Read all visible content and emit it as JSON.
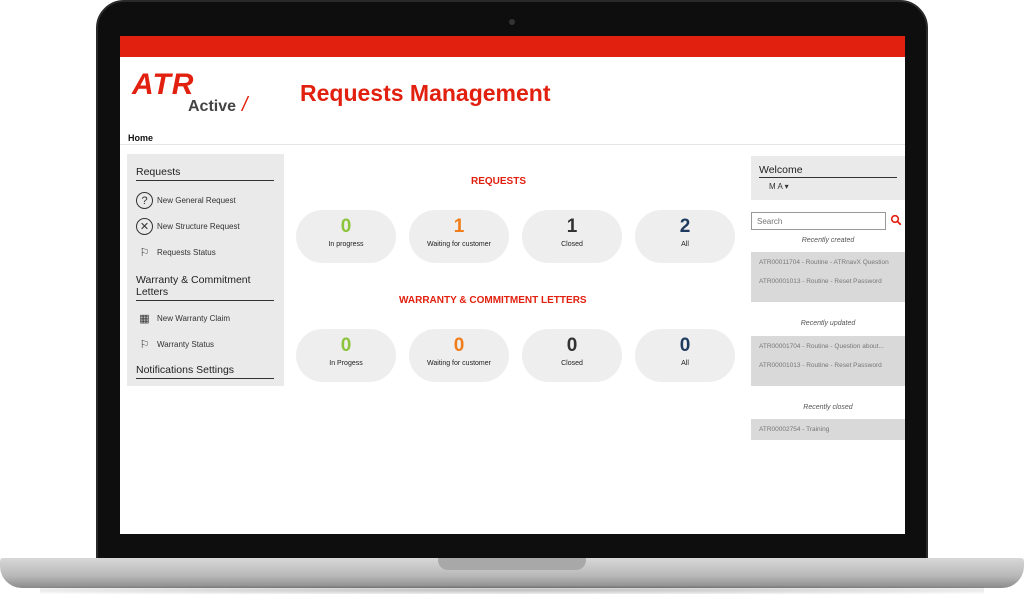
{
  "app": {
    "logo_brand": "ATR",
    "logo_sub": "Active",
    "title": "Requests Management",
    "breadcrumb": "Home",
    "accent_color": "#e2200f"
  },
  "sidebar": {
    "requests_heading": "Requests",
    "requests_items": [
      {
        "label": "New General Request",
        "icon": "question-bulb-icon"
      },
      {
        "label": "New Structure Request",
        "icon": "tools-icon"
      },
      {
        "label": "Requests Status",
        "icon": "flag-icon"
      }
    ],
    "warranty_heading": "Warranty & Commitment Letters",
    "warranty_items": [
      {
        "label": "New Warranty Claim",
        "icon": "calculator-icon"
      },
      {
        "label": "Warranty Status",
        "icon": "flag-icon"
      }
    ],
    "notifications_heading": "Notifications Settings"
  },
  "requests": {
    "title": "REQUESTS",
    "stats": [
      {
        "value": "0",
        "label": "In progress",
        "color": "#8cc43c"
      },
      {
        "value": "1",
        "label": "Waiting for customer",
        "color": "#f07d1a"
      },
      {
        "value": "1",
        "label": "Closed",
        "color": "#333333"
      },
      {
        "value": "2",
        "label": "All",
        "color": "#1f3a5f"
      }
    ]
  },
  "warranty": {
    "title": "WARRANTY & COMMITMENT LETTERS",
    "stats": [
      {
        "value": "0",
        "label": "In Progess",
        "color": "#8cc43c"
      },
      {
        "value": "0",
        "label": "Waiting for customer",
        "color": "#f07d1a"
      },
      {
        "value": "0",
        "label": "Closed",
        "color": "#333333"
      },
      {
        "value": "0",
        "label": "All",
        "color": "#1f3a5f"
      }
    ]
  },
  "right_panel": {
    "welcome": "Welcome",
    "user": "M A ▾",
    "search_placeholder": "Search",
    "recently_created_label": "Recently created",
    "recently_created": [
      "ATR00011704 - Routine - ATRnavX Question",
      "ATR00001013 - Routine - Reset Password"
    ],
    "recently_updated_label": "Recently updated",
    "recently_updated": [
      "ATR00001704 - Routine - Question about...",
      "ATR00001013 - Routine - Reset Password"
    ],
    "recently_closed_label": "Recently closed",
    "recently_closed": [
      "ATR00002754 - Training"
    ]
  }
}
